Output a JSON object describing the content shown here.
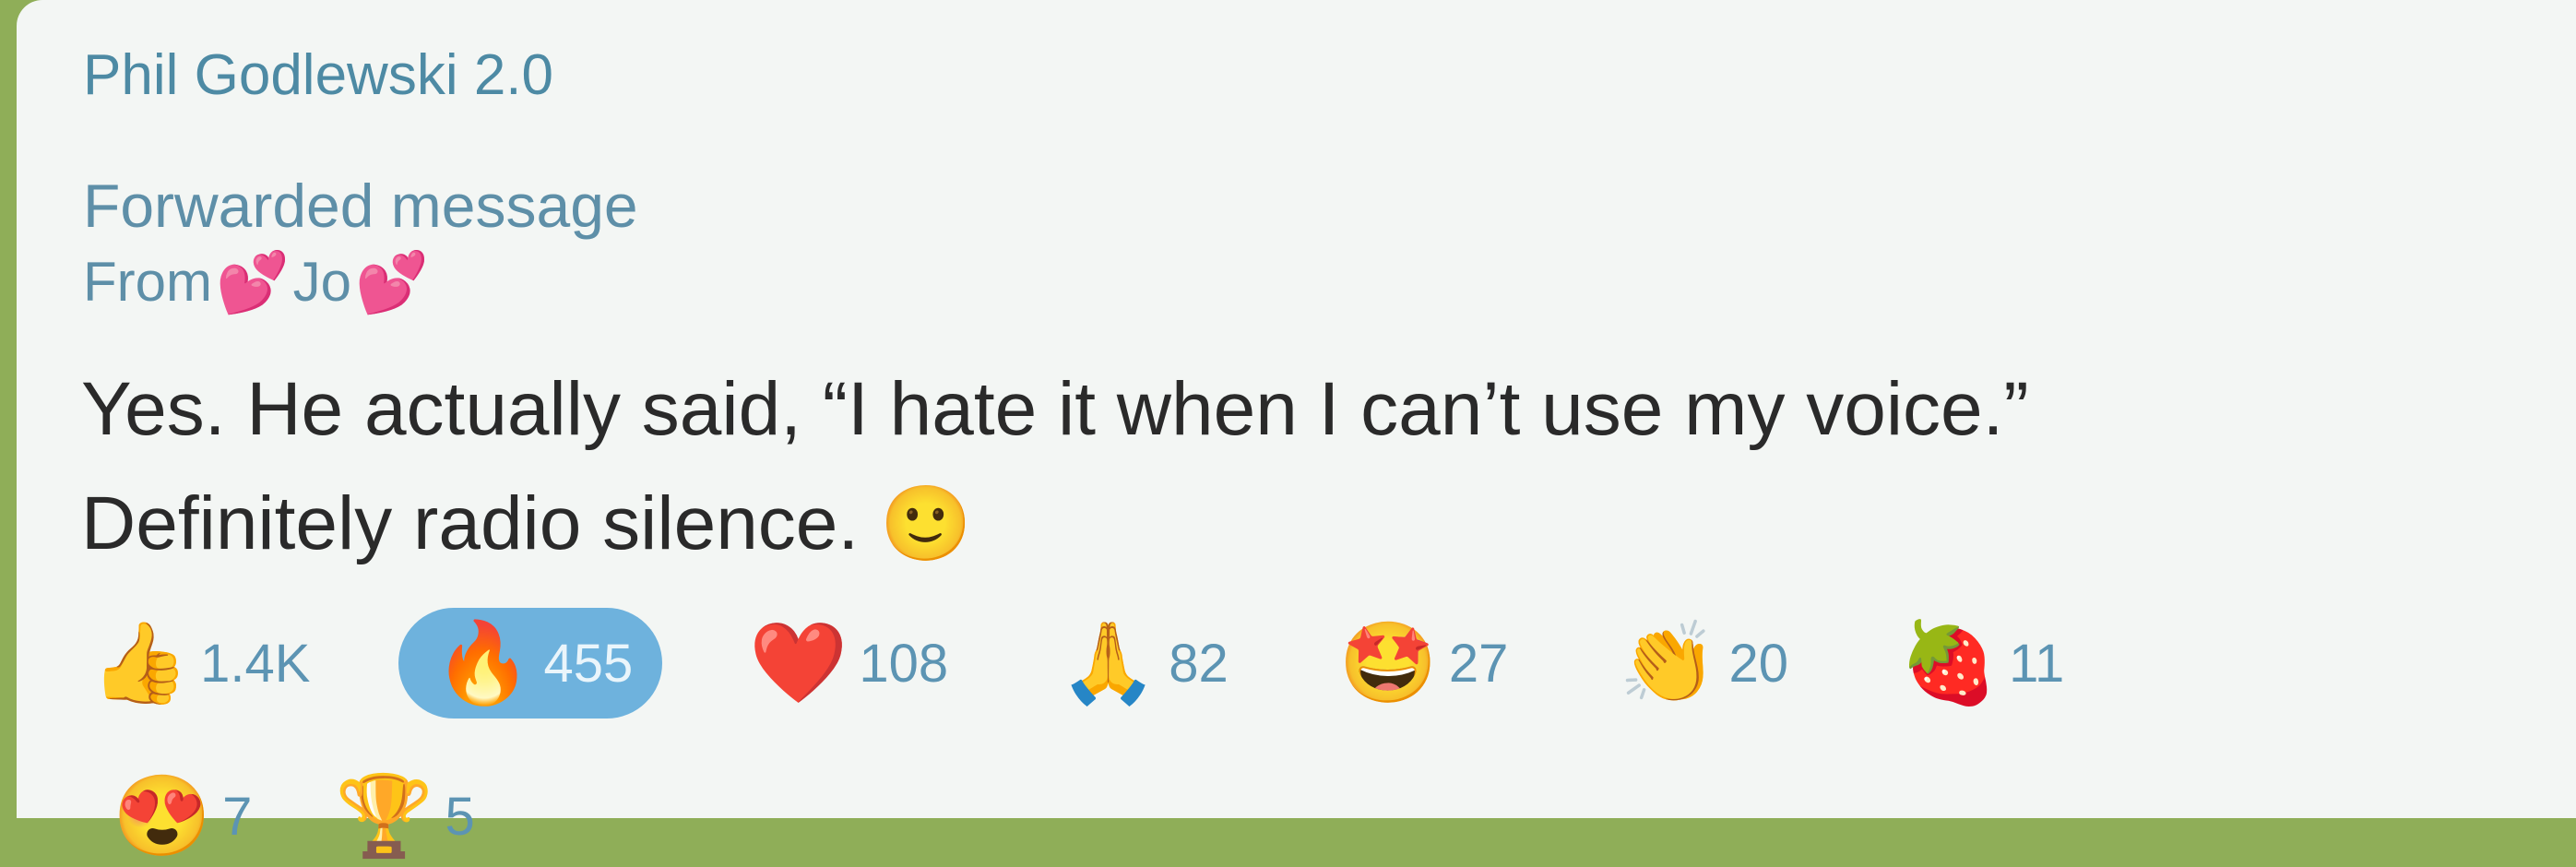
{
  "message": {
    "sender": "Phil Godlewski 2.0",
    "forwarded_label": "Forwarded message",
    "from_prefix": "From",
    "from_name": "Jo",
    "from_heart_emoji": "💕",
    "text_line1": "Yes. He actually said, “I hate it when I can’t use my voice.”",
    "text_line2": "Definitely radio silence.",
    "text_emoji": "🙂"
  },
  "reactions": [
    {
      "emoji": "👍",
      "count": "1.4K",
      "active": false
    },
    {
      "emoji": "🔥",
      "count": "455",
      "active": true
    },
    {
      "emoji": "❤️",
      "count": "108",
      "active": false
    },
    {
      "emoji": "🙏",
      "count": "82",
      "active": false
    },
    {
      "emoji": "🤩",
      "count": "27",
      "active": false
    },
    {
      "emoji": "👏",
      "count": "20",
      "active": false
    },
    {
      "emoji": "🍓",
      "count": "11",
      "active": false
    }
  ],
  "reactions_row2": [
    {
      "emoji": "😍",
      "count": "7"
    },
    {
      "emoji": "🏆",
      "count": "5"
    }
  ],
  "colors": {
    "bubble_bg": "#f3f6f4",
    "link_blue": "#5e8fa8",
    "active_reaction_bg": "#6eb2dd"
  }
}
